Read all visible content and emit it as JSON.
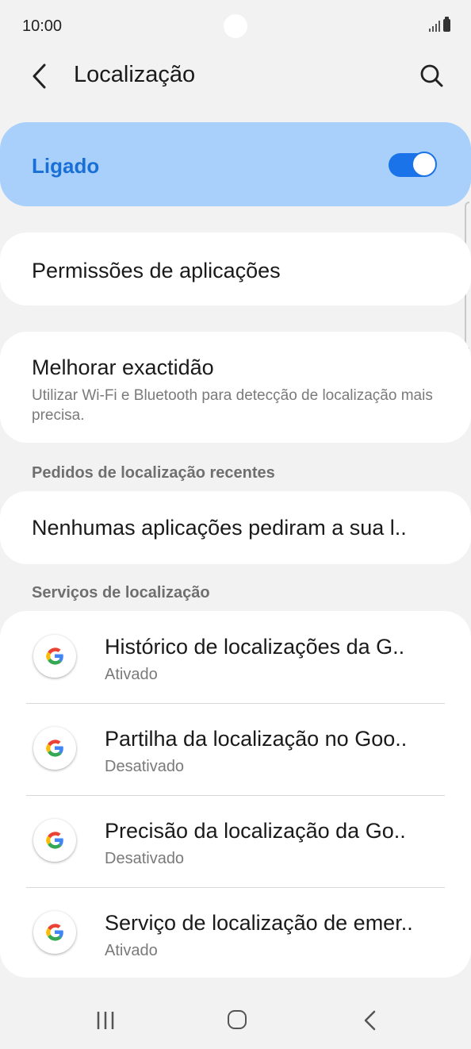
{
  "status_bar": {
    "time": "10:00",
    "signal_icon": "signal-icon",
    "battery_icon": "battery-icon"
  },
  "header": {
    "title": "Localização",
    "back_icon": "back-arrow-icon",
    "search_icon": "search-icon"
  },
  "master_toggle": {
    "label": "Ligado",
    "checked": true,
    "accent_color": "#1a73e8",
    "background": "#a8d0fa"
  },
  "app_permissions": {
    "label": "Permissões de aplicações"
  },
  "improve_accuracy": {
    "title": "Melhorar exactidão",
    "subtitle": "Utilizar Wi-Fi e Bluetooth para detecção de localização mais precisa."
  },
  "recent_requests": {
    "header": "Pedidos de localização recentes",
    "empty_label": "Nenhumas aplicações pediram a sua l.."
  },
  "location_services": {
    "header": "Serviços de localização",
    "items": [
      {
        "title": "Histórico de localizações da G..",
        "status": "Ativado",
        "icon": "google-icon"
      },
      {
        "title": "Partilha da localização no Goo..",
        "status": "Desativado",
        "icon": "google-icon"
      },
      {
        "title": "Precisão da localização da Go..",
        "status": "Desativado",
        "icon": "google-icon"
      },
      {
        "title": "Serviço de localização de emer..",
        "status": "Ativado",
        "icon": "google-icon"
      }
    ]
  },
  "nav_bar": {
    "recents_icon": "recents-icon",
    "home_icon": "home-icon",
    "back_icon": "nav-back-icon"
  }
}
